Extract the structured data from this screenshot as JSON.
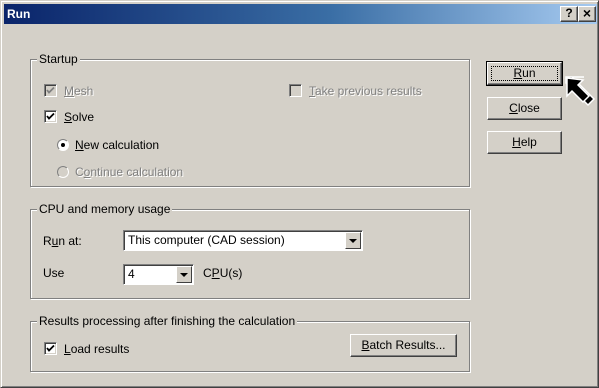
{
  "window": {
    "title": "Run",
    "help_glyph": "?",
    "close_glyph": "×"
  },
  "startup": {
    "legend": "Startup",
    "mesh": {
      "pre": "",
      "key": "M",
      "post": "esh",
      "checked": true,
      "enabled": false
    },
    "take_previous": {
      "pre": "",
      "key": "T",
      "post": "ake previous results",
      "checked": false,
      "enabled": false
    },
    "solve": {
      "pre": "",
      "key": "S",
      "post": "olve",
      "checked": true,
      "enabled": true
    },
    "new_calc": {
      "pre": "",
      "key": "N",
      "post": "ew calculation",
      "selected": true,
      "enabled": true
    },
    "continue_calc": {
      "pre": "C",
      "key": "o",
      "post": "ntinue calculation",
      "selected": false,
      "enabled": false
    }
  },
  "cpu": {
    "legend": "CPU and memory usage",
    "run_at_label": {
      "pre": "R",
      "key": "u",
      "post": "n at:"
    },
    "run_at_value": "This computer (CAD session)",
    "use_label": "Use",
    "use_value": "4",
    "cpus_label": {
      "pre": "C",
      "key": "P",
      "post": "U(s)"
    }
  },
  "results": {
    "legend": "Results processing after finishing the calculation",
    "load": {
      "pre": "",
      "key": "L",
      "post": "oad results",
      "checked": true,
      "enabled": true
    },
    "batch_button": {
      "pre": "",
      "key": "B",
      "post": "atch Results..."
    }
  },
  "buttons": {
    "run": {
      "pre": "",
      "key": "R",
      "post": "un"
    },
    "close": {
      "pre": "",
      "key": "C",
      "post": "lose"
    },
    "help": {
      "pre": "",
      "key": "H",
      "post": "elp"
    }
  },
  "icons": {
    "checkmark": "check-icon",
    "cursor": "mouse-pointer-icon",
    "dropdown": "chevron-down-icon"
  }
}
